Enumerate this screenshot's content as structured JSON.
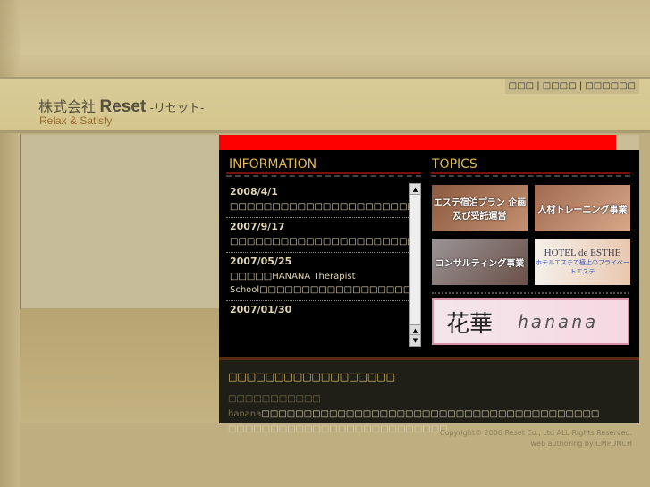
{
  "header": {
    "logo_jp": "株式会社",
    "logo_en": "Reset",
    "logo_kana": "-リセット-",
    "tagline": "Relax & Satisfy",
    "nav": [
      "□□□",
      "□□□□",
      "□□□□□□"
    ]
  },
  "information": {
    "title": "INFORMATION",
    "items": [
      {
        "date": "2008/4/1",
        "text": "□□□□□□□□□□□□□□□□□□□□□□□HOTEL□DE□ESTHE□□□□□□□□□□□□□"
      },
      {
        "date": "2007/9/17",
        "text": "□□□□□□□□□□□□□□□□□□□□□□□□□□□HOTEL□DE□ESTHE□□□□□□□□□□□□□□"
      },
      {
        "date": "2007/05/25",
        "text": "□□□□□HANANA Therapist School□□□□□□□□□□□□□□□□□□□□□"
      },
      {
        "date": "2007/01/30",
        "text": ""
      }
    ]
  },
  "topics": {
    "title": "TOPICS",
    "tiles": [
      {
        "label": "エステ宿泊プラン 企画及び受託運営"
      },
      {
        "label": "人材トレーニング事業"
      },
      {
        "label": "コンサルティング事業"
      },
      {
        "label": "HOTEL de ESTHE",
        "sub": "ホテルエステで極上のプライベートエステ"
      }
    ],
    "banner": {
      "logo": "花華",
      "text": "hanana"
    }
  },
  "bottom": {
    "title": "□□□□□□□□□□□□□□□□□□",
    "lead": "□□□□□□□□□□□ hanana",
    "text": "□□□□□□□□□□□□□□□□□□□□□□□□□□□□□□□□□□□□□□□□ □□□□□□□□□□□□□□□□□□□□□□□□□□"
  },
  "footer": {
    "copyright": "Copyright© 2006 Reset Co., Ltd ALL Rights Reserved.",
    "credit": "web authoring by CMPUNCH"
  }
}
